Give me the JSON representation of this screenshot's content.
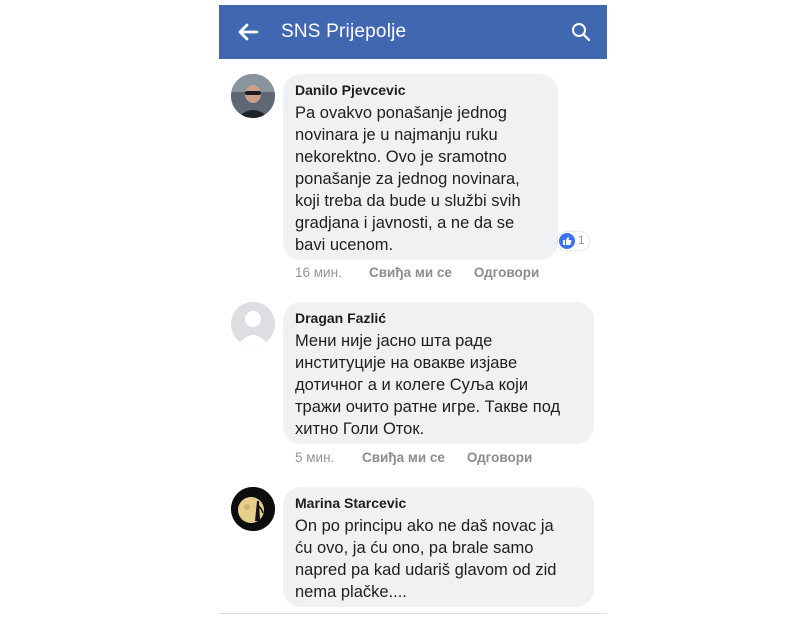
{
  "header": {
    "title": "SNS Prijepolje",
    "back_icon": "arrow-left-icon",
    "search_icon": "search-icon",
    "bg_color": "#4167b1"
  },
  "comments": [
    {
      "author": "Danilo Pjevcevic",
      "text": "Pa ovakvo ponašanje jednog\nnovinara je u najmanju ruku\nnekorektno. Ovo je sramotno\nponašanje za jednog novinara,\nkoji treba da bude u službi svih\ngradjana i javnosti, a ne da se\nbavi ucenom.",
      "time": "16 мин.",
      "like_label": "Свиђа ми се",
      "reply_label": "Одговори",
      "reaction_count": "1"
    },
    {
      "author": "Dragan Fazlić",
      "text": "Мени није јасно шта раде\nинституције на овакве изјаве\nдотичног а и колеге Суља који\nтражи очито ратне игре. Такве под\nхитно Голи Оток.",
      "time": "5 мин.",
      "like_label": "Свиђа ми се",
      "reply_label": "Одговори"
    },
    {
      "author": "Marina Starcevic",
      "text": "On po principu ako ne daš novac ja\nću ovo, ja ću ono, pa brale samo\nnapred pa kad udariš glavom od zid\nnema plačke...."
    }
  ]
}
